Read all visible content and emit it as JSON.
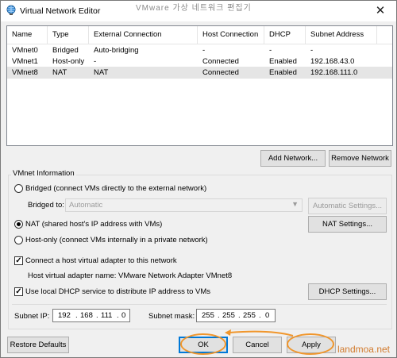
{
  "window": {
    "title": "Virtual Network Editor",
    "background_title": "VMware 가상 네트워크 편집기",
    "close_glyph": "✕"
  },
  "network_list": {
    "columns": [
      "Name",
      "Type",
      "External Connection",
      "Host Connection",
      "DHCP",
      "Subnet Address"
    ],
    "rows": [
      {
        "name": "VMnet0",
        "type": "Bridged",
        "external": "Auto-bridging",
        "host": "-",
        "dhcp": "-",
        "subnet": "-"
      },
      {
        "name": "VMnet1",
        "type": "Host-only",
        "external": "-",
        "host": "Connected",
        "dhcp": "Enabled",
        "subnet": "192.168.43.0"
      },
      {
        "name": "VMnet8",
        "type": "NAT",
        "external": "NAT",
        "host": "Connected",
        "dhcp": "Enabled",
        "subnet": "192.168.111.0"
      }
    ],
    "selected_row": "VMnet8"
  },
  "list_buttons": {
    "add_network": "Add Network...",
    "remove_network": "Remove Network"
  },
  "vmnet_info": {
    "group_label": "VMnet Information",
    "bridged_label": "Bridged (connect VMs directly to the external network)",
    "bridged_to_label": "Bridged to:",
    "bridged_to_value": "Automatic",
    "automatic_settings": "Automatic Settings...",
    "nat_label": "NAT (shared host's IP address with VMs)",
    "nat_settings": "NAT Settings...",
    "hostonly_label": "Host-only (connect VMs internally in a private network)",
    "selected_mode": "NAT",
    "connect_adapter_label": "Connect a host virtual adapter to this network",
    "connect_adapter_checked": true,
    "adapter_name_label": "Host virtual adapter name: VMware Network Adapter VMnet8",
    "dhcp_label": "Use local DHCP service to distribute IP address to VMs",
    "dhcp_checked": true,
    "dhcp_settings": "DHCP Settings...",
    "subnet_ip_label": "Subnet IP:",
    "subnet_ip": [
      "192",
      "168",
      "111",
      "0"
    ],
    "subnet_mask_label": "Subnet mask:",
    "subnet_mask": [
      "255",
      "255",
      "255",
      "0"
    ]
  },
  "footer": {
    "restore_defaults": "Restore Defaults",
    "ok": "OK",
    "cancel": "Cancel",
    "apply": "Apply"
  },
  "annotation_color": "#f0962c",
  "watermark": "landmoa.net"
}
